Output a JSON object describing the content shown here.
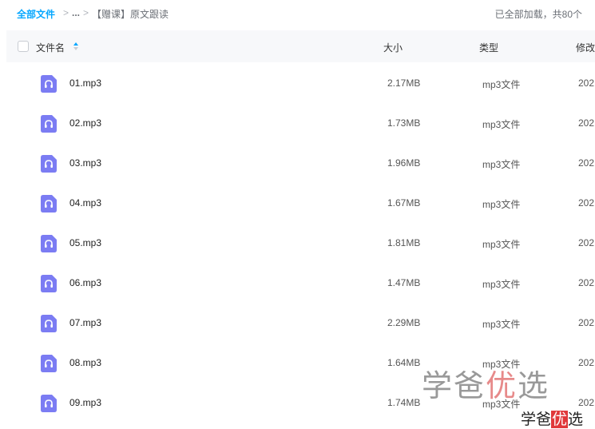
{
  "breadcrumb": {
    "root": "全部文件",
    "sep": ">",
    "ellipsis": "...",
    "current": "【赠课】原文跟读"
  },
  "load_status": "已全部加载，共80个",
  "header": {
    "name": "文件名",
    "size": "大小",
    "type": "类型",
    "modified": "修改"
  },
  "files": [
    {
      "name": "01.mp3",
      "size": "2.17MB",
      "type": "mp3文件",
      "modified": "202"
    },
    {
      "name": "02.mp3",
      "size": "1.73MB",
      "type": "mp3文件",
      "modified": "202"
    },
    {
      "name": "03.mp3",
      "size": "1.96MB",
      "type": "mp3文件",
      "modified": "202"
    },
    {
      "name": "04.mp3",
      "size": "1.67MB",
      "type": "mp3文件",
      "modified": "202"
    },
    {
      "name": "05.mp3",
      "size": "1.81MB",
      "type": "mp3文件",
      "modified": "202"
    },
    {
      "name": "06.mp3",
      "size": "1.47MB",
      "type": "mp3文件",
      "modified": "202"
    },
    {
      "name": "07.mp3",
      "size": "2.29MB",
      "type": "mp3文件",
      "modified": "202"
    },
    {
      "name": "08.mp3",
      "size": "1.64MB",
      "type": "mp3文件",
      "modified": "202"
    },
    {
      "name": "09.mp3",
      "size": "1.74MB",
      "type": "mp3文件",
      "modified": "202"
    }
  ],
  "watermark": {
    "big_a": "学爸",
    "big_hl": "优",
    "big_b": "选",
    "small_a": "学爸",
    "small_hl": "优",
    "small_b": "选"
  },
  "colors": {
    "accent": "#06a7ff",
    "icon": "#7b7cf3",
    "header_bg": "#f7f8fa"
  },
  "icons": {
    "file": "audio-file-icon",
    "sort": "sort-ascending-icon"
  }
}
